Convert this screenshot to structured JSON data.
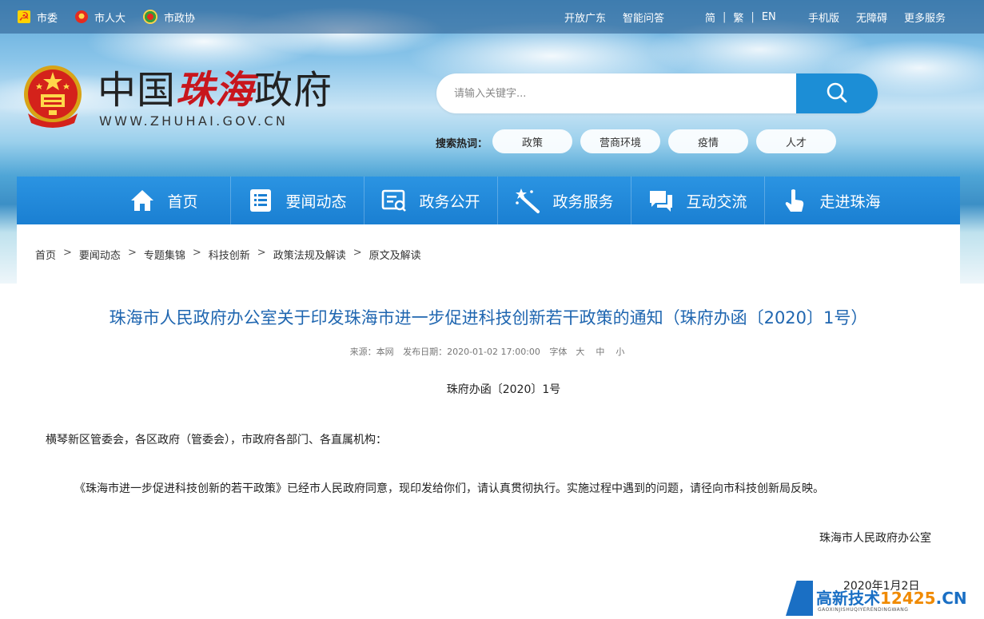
{
  "topbar": {
    "left_links": [
      "市委",
      "市人大",
      "市政协"
    ],
    "mid_links": [
      "开放广东",
      "智能问答"
    ],
    "languages": [
      "简",
      "繁",
      "EN"
    ],
    "right_links": [
      "手机版",
      "无障碍",
      "更多服务"
    ]
  },
  "logo": {
    "title_prefix": "中国",
    "title_city": "珠海",
    "title_suffix": "政府",
    "url": "WWW.ZHUHAI.GOV.CN"
  },
  "search": {
    "placeholder": "请输入关键字...",
    "hot_label": "搜索热词：",
    "hot_words": [
      "政策",
      "营商环境",
      "疫情",
      "人才"
    ]
  },
  "nav": {
    "items": [
      {
        "label": "首页",
        "icon": "home-icon"
      },
      {
        "label": "要闻动态",
        "icon": "news-icon"
      },
      {
        "label": "政务公开",
        "icon": "gov-open-icon"
      },
      {
        "label": "政务服务",
        "icon": "service-wand-icon"
      },
      {
        "label": "互动交流",
        "icon": "chat-icon"
      },
      {
        "label": "走进珠海",
        "icon": "pointer-hand-icon"
      }
    ]
  },
  "breadcrumb": [
    "首页",
    "要闻动态",
    "专题集锦",
    "科技创新",
    "政策法规及解读",
    "原文及解读"
  ],
  "breadcrumb_sep": ">",
  "article": {
    "title": "珠海市人民政府办公室关于印发珠海市进一步促进科技创新若干政策的通知（珠府办函〔2020〕1号）",
    "source": "来源：本网",
    "publish_date": "发布日期：2020-01-02 17:00:00",
    "font_label": "字体",
    "font_sizes": [
      "大",
      "中",
      "小"
    ],
    "doc_number": "珠府办函〔2020〕1号",
    "addressee": "横琴新区管委会，各区政府（管委会），市政府各部门、各直属机构：",
    "body": "《珠海市进一步促进科技创新的若干政策》已经市人民政府同意，现印发给你们，请认真贯彻执行。实施过程中遇到的问题，请径向市科技创新局反映。",
    "signer": "珠海市人民政府办公室",
    "sign_date": "2020年1月2日"
  },
  "watermark": {
    "text": "高新技术",
    "num": "12425",
    "tld": ".CN",
    "sub": "GAOXINJISHUQIYERENDINGWANG"
  },
  "colors": {
    "nav_blue": "#1a7fd2",
    "title_blue": "#1f66b0",
    "city_red": "#c8161d",
    "search_button": "#1c8ed6"
  }
}
